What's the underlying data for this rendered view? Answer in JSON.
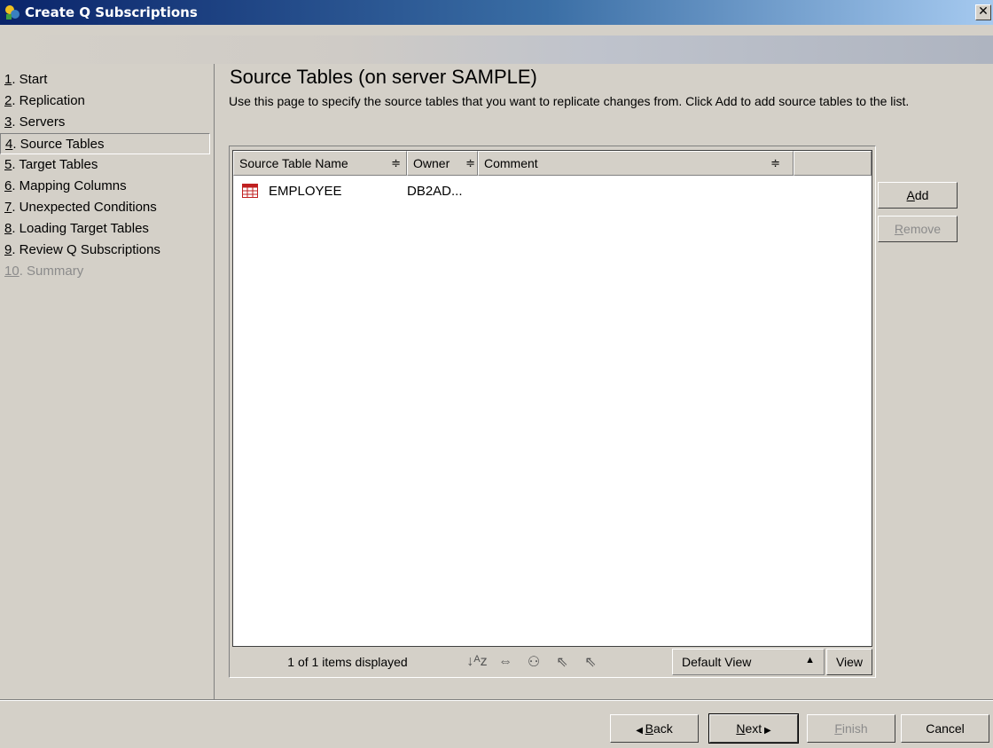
{
  "window": {
    "title": "Create Q Subscriptions",
    "close_label": "✕"
  },
  "sidebar": {
    "items": [
      {
        "num": "1",
        "label": ". Start",
        "state": "normal"
      },
      {
        "num": "2",
        "label": ". Replication",
        "state": "normal"
      },
      {
        "num": "3",
        "label": ". Servers",
        "state": "normal"
      },
      {
        "num": "4",
        "label": ". Source Tables",
        "state": "active"
      },
      {
        "num": "5",
        "label": ". Target Tables",
        "state": "normal"
      },
      {
        "num": "6",
        "label": ". Mapping Columns",
        "state": "normal"
      },
      {
        "num": "7",
        "label": ". Unexpected Conditions",
        "state": "normal"
      },
      {
        "num": "8",
        "label": ". Loading Target Tables",
        "state": "normal"
      },
      {
        "num": "9",
        "label": ". Review Q Subscriptions",
        "state": "normal"
      },
      {
        "num": "10",
        "label": ". Summary",
        "state": "disabled"
      }
    ]
  },
  "page": {
    "title": "Source Tables (on server SAMPLE)",
    "description": "Use this page to specify the source tables that you want to replicate changes from. Click Add to add source tables to the list."
  },
  "table": {
    "columns": [
      "Source Table Name",
      "Owner",
      "Comment"
    ],
    "sort_glyph": "≑",
    "rows": [
      {
        "name": "EMPLOYEE",
        "owner": "DB2AD...",
        "comment": ""
      }
    ],
    "status": "1 of 1 items displayed",
    "view_selected": "Default View",
    "view_arrow": "▲",
    "view_button": "View",
    "tools": {
      "sort": "↓ᴬz",
      "filter": "⇔",
      "find": "⚇",
      "select_all": "⇖",
      "deselect_all": "⇖"
    }
  },
  "side_buttons": {
    "add": {
      "mnemonic": "A",
      "rest": "dd"
    },
    "remove": {
      "mnemonic": "R",
      "rest": "emove"
    }
  },
  "footer": {
    "back": {
      "arrow": "◀ ",
      "mnemonic": "B",
      "rest": "ack"
    },
    "next": {
      "mnemonic": "N",
      "rest": "ext",
      "arrow": " ▶"
    },
    "finish": {
      "mnemonic": "F",
      "rest": "inish"
    },
    "cancel": "Cancel"
  }
}
